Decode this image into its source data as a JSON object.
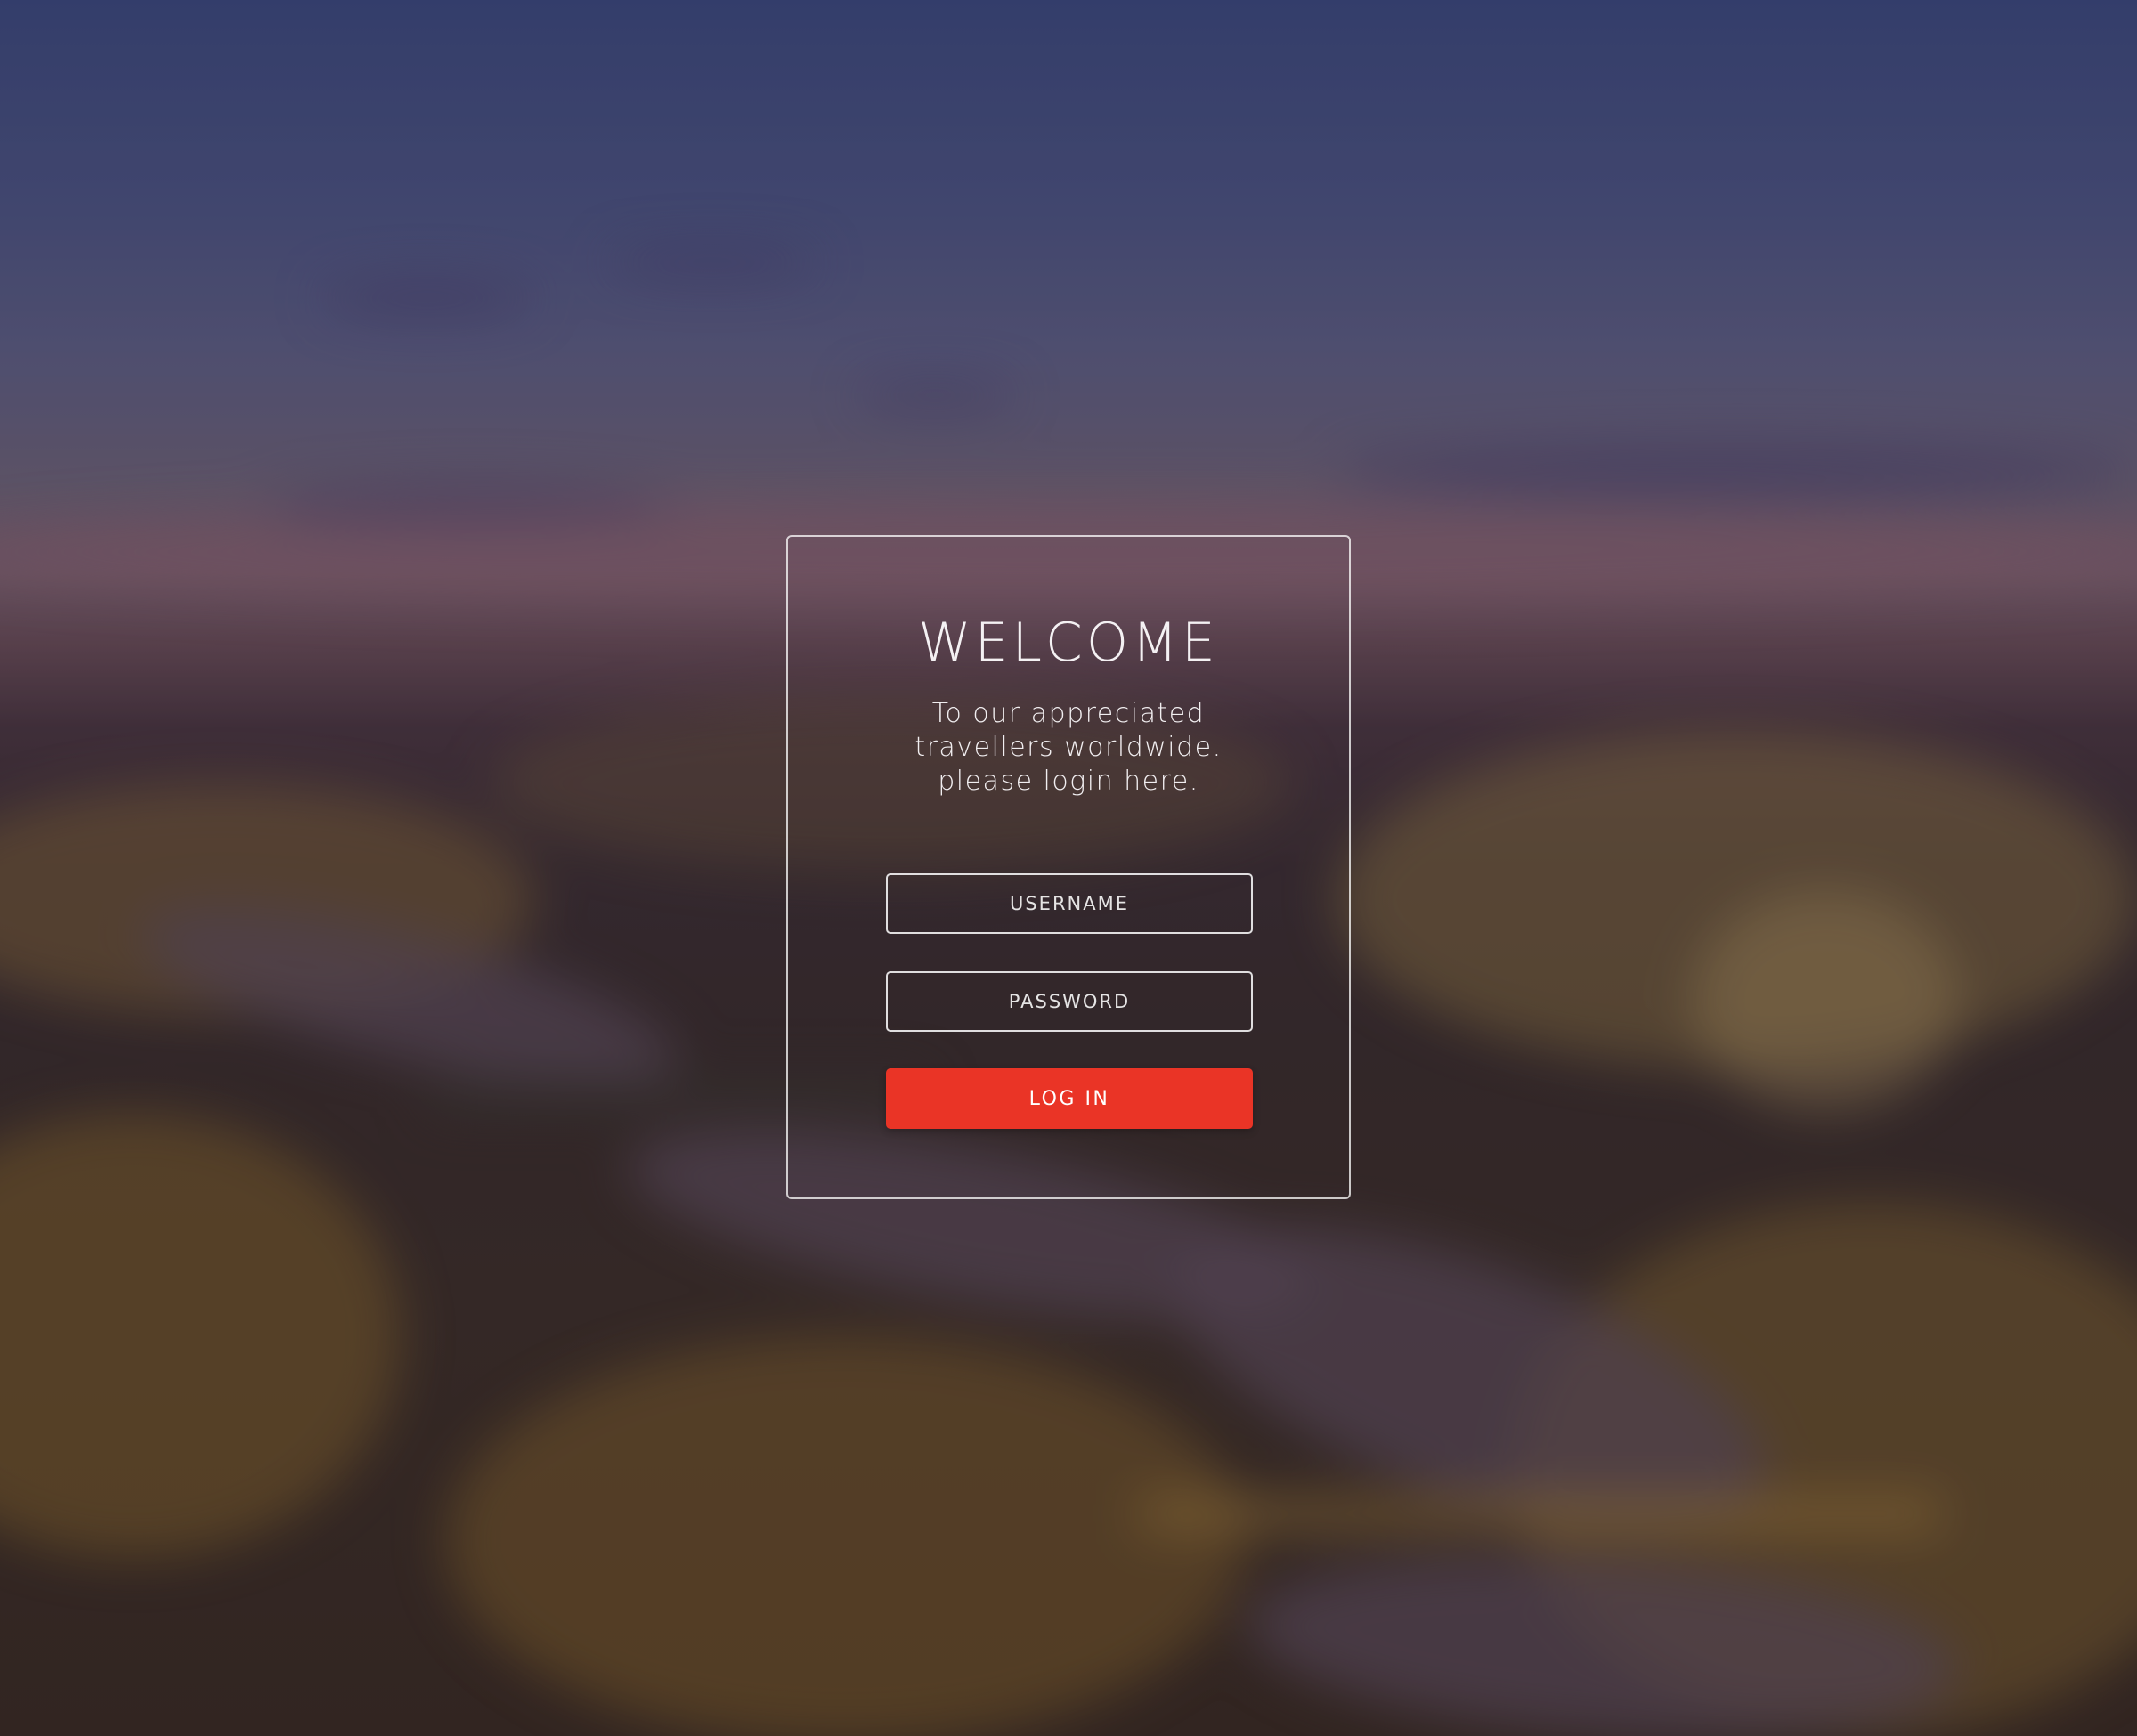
{
  "login": {
    "title": "WELCOME",
    "subtitle_lines": [
      "To our appreciated",
      "travellers worldwide.",
      "please login here."
    ],
    "username_placeholder": "USERNAME",
    "password_placeholder": "PASSWORD",
    "submit_label": "LOG IN"
  },
  "colors": {
    "accent": "#ea3426",
    "card_border": "#ffffff"
  }
}
